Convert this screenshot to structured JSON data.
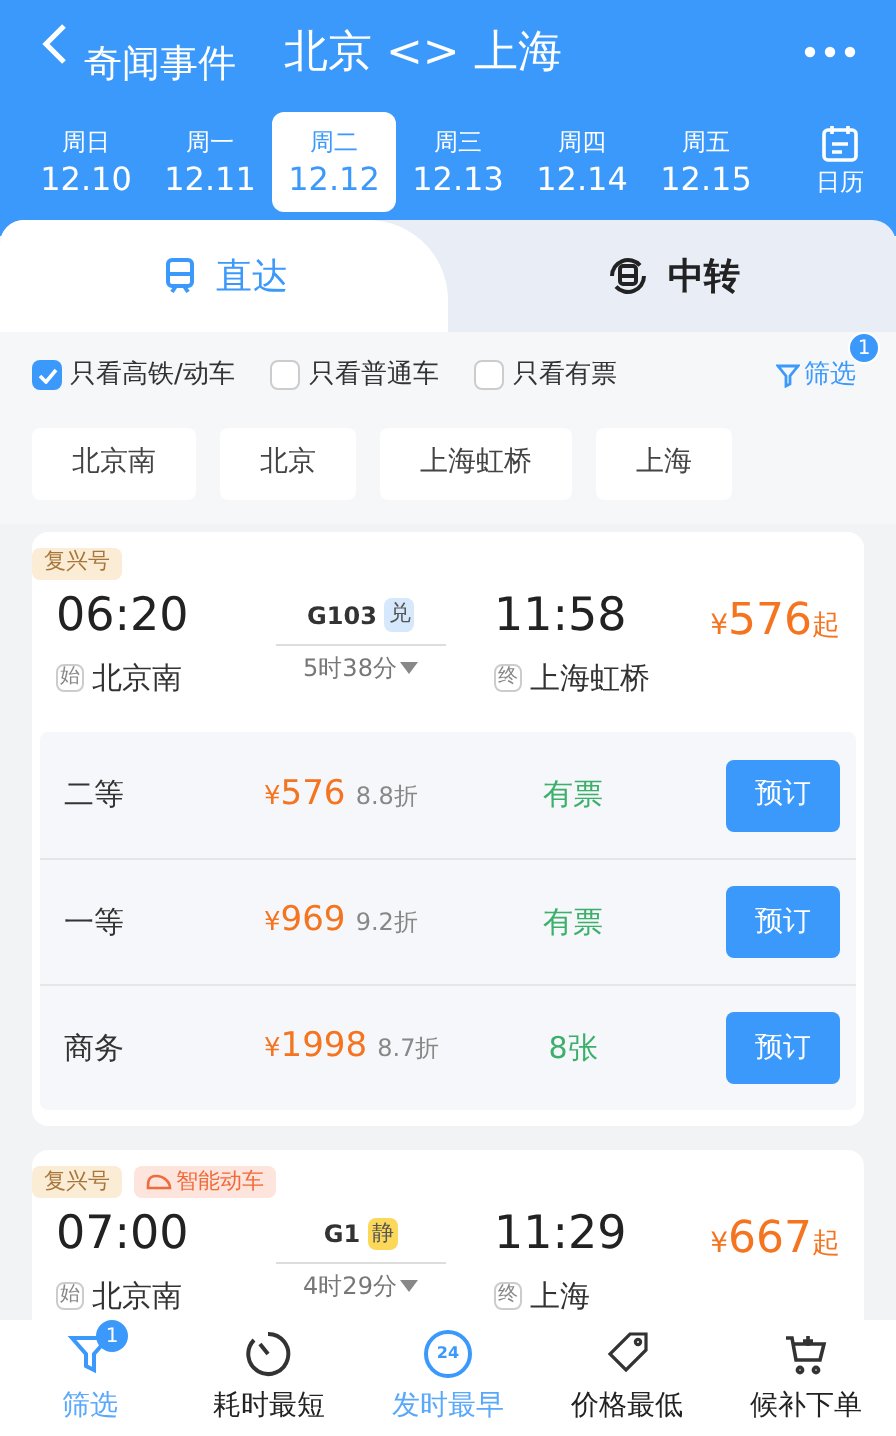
{
  "header": {
    "back_label": "奇闻事件",
    "title": "北京 <> 上海"
  },
  "dates": [
    {
      "weekday": "周日",
      "date": "12.10",
      "selected": false
    },
    {
      "weekday": "周一",
      "date": "12.11",
      "selected": false
    },
    {
      "weekday": "周二",
      "date": "12.12",
      "selected": true
    },
    {
      "weekday": "周三",
      "date": "12.13",
      "selected": false
    },
    {
      "weekday": "周四",
      "date": "12.14",
      "selected": false
    },
    {
      "weekday": "周五",
      "date": "12.15",
      "selected": false
    }
  ],
  "calendar_label": "日历",
  "route_tabs": [
    {
      "label": "直达",
      "selected": true,
      "kind": "direct"
    },
    {
      "label": "中转",
      "selected": false,
      "kind": "transfer"
    }
  ],
  "filters": [
    {
      "label": "只看高铁/动车",
      "checked": true
    },
    {
      "label": "只看普通车",
      "checked": false
    },
    {
      "label": "只看有票",
      "checked": false
    }
  ],
  "filter_button": {
    "label": "筛选",
    "badge": "1"
  },
  "stations": [
    "北京南",
    "北京",
    "上海虹桥",
    "上海"
  ],
  "trains": [
    {
      "tags": [
        {
          "label": "复兴号",
          "kind": "plain"
        }
      ],
      "depart": "06:20",
      "train_no": "G103",
      "train_badge": {
        "label": "兑",
        "color": "#d6e8fb"
      },
      "arrive": "11:58",
      "currency": "¥",
      "price": "576",
      "price_suffix": "起",
      "from_mark": "始",
      "from": "北京南",
      "duration": "5时38分",
      "to_mark": "终",
      "to": "上海虹桥",
      "seats": [
        {
          "class": "二等",
          "currency": "¥",
          "price": "576",
          "discount": "8.8折",
          "availability": "有票",
          "button": "预订"
        },
        {
          "class": "一等",
          "currency": "¥",
          "price": "969",
          "discount": "9.2折",
          "availability": "有票",
          "button": "预订"
        },
        {
          "class": "商务",
          "currency": "¥",
          "price": "1998",
          "discount": "8.7折",
          "availability": "8张",
          "button": "预订"
        }
      ]
    },
    {
      "tags": [
        {
          "label": "复兴号",
          "kind": "plain"
        },
        {
          "label": "智能动车",
          "kind": "smart"
        }
      ],
      "depart": "07:00",
      "train_no": "G1",
      "train_badge": {
        "label": "静",
        "color": "#fbd85a"
      },
      "arrive": "11:29",
      "currency": "¥",
      "price": "667",
      "price_suffix": "起",
      "from_mark": "始",
      "from": "北京南",
      "duration": "4时29分",
      "to_mark": "终",
      "to": "上海"
    }
  ],
  "bottom_nav": [
    {
      "label": "筛选",
      "kind": "filter",
      "selected": true,
      "badge": "1"
    },
    {
      "label": "耗时最短",
      "kind": "timer",
      "selected": false
    },
    {
      "label": "发时最早",
      "kind": "clock24",
      "selected": true,
      "icon_text": "24"
    },
    {
      "label": "价格最低",
      "kind": "tag",
      "selected": false
    },
    {
      "label": "候补下单",
      "kind": "cart",
      "selected": false
    }
  ]
}
